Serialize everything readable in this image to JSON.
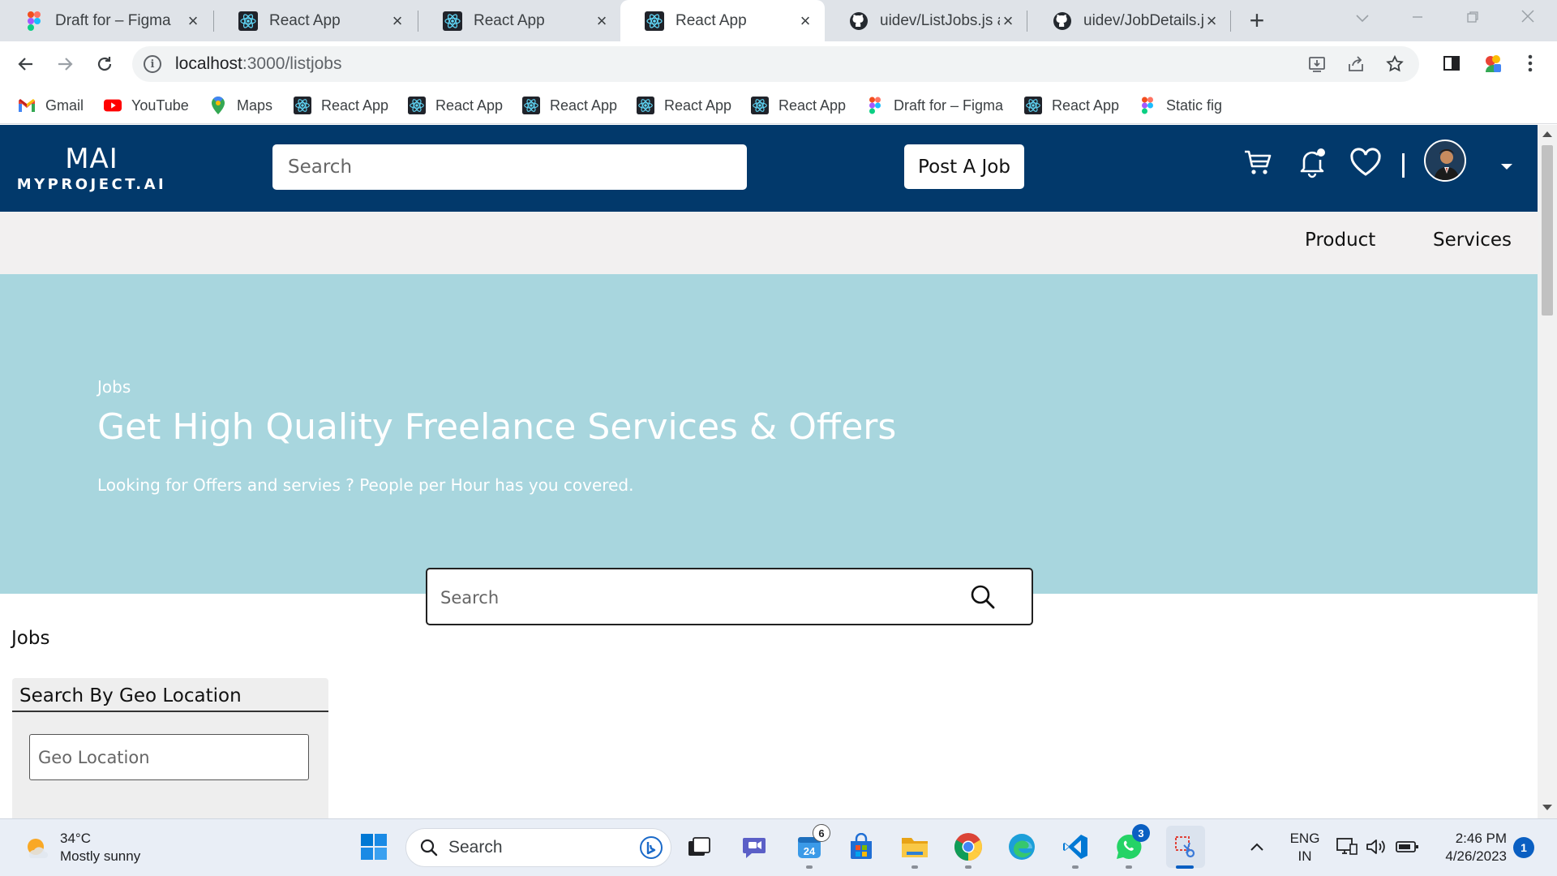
{
  "browser": {
    "tabs": [
      {
        "title": "Draft for – Figma",
        "icon": "figma-icon",
        "active": false
      },
      {
        "title": "React App",
        "icon": "react-icon",
        "active": false
      },
      {
        "title": "React App",
        "icon": "react-icon",
        "active": false
      },
      {
        "title": "React App",
        "icon": "react-icon",
        "active": true
      },
      {
        "title": "uidev/ListJobs.js at",
        "icon": "github-icon",
        "active": false
      },
      {
        "title": "uidev/JobDetails.js",
        "icon": "github-icon",
        "active": false
      }
    ],
    "url_host": "localhost",
    "url_path": ":3000/listjobs",
    "bookmarks": [
      {
        "label": "Gmail",
        "icon": "gmail-icon"
      },
      {
        "label": "YouTube",
        "icon": "youtube-icon"
      },
      {
        "label": "Maps",
        "icon": "maps-icon"
      },
      {
        "label": "React App",
        "icon": "react-icon"
      },
      {
        "label": "React App",
        "icon": "react-icon"
      },
      {
        "label": "React App",
        "icon": "react-icon"
      },
      {
        "label": "React App",
        "icon": "react-icon"
      },
      {
        "label": "React App",
        "icon": "react-icon"
      },
      {
        "label": "Draft for – Figma",
        "icon": "figma-icon"
      },
      {
        "label": "React App",
        "icon": "react-icon"
      },
      {
        "label": "Static fig",
        "icon": "figma-icon"
      }
    ]
  },
  "site": {
    "logo_mark": "MAI",
    "logo_word": "MYPROJECT.AI",
    "header_search_placeholder": "Search",
    "post_job_label": "Post A Job",
    "nav": [
      "Product",
      "Services"
    ],
    "colors": {
      "header": "#02396b",
      "subnav": "#f2f0f0",
      "hero": "#a8d6de"
    }
  },
  "hero": {
    "breadcrumb": "Jobs",
    "title": "Get High Quality Freelance Services & Offers",
    "subtitle": "Looking for Offers and servies ? People per Hour has you covered."
  },
  "main": {
    "search_placeholder": "Search",
    "jobs_label": "Jobs",
    "filter": {
      "heading": "Search By Geo Location",
      "geo_placeholder": "Geo Location"
    }
  },
  "taskbar": {
    "weather_temp": "34°C",
    "weather_desc": "Mostly sunny",
    "search_label": "Search",
    "widgets_badge": "6",
    "whatsapp_badge": "3",
    "lang_1": "ENG",
    "lang_2": "IN",
    "time": "2:46 PM",
    "date": "4/26/2023",
    "notification_count": "1",
    "calendar_day": "24"
  }
}
